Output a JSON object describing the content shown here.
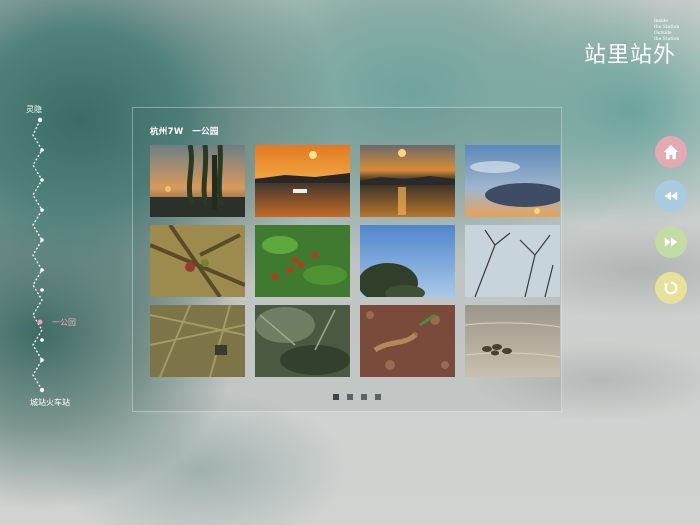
{
  "gallery": {
    "title": "杭州7W　一公园",
    "photos": [
      {
        "name": "willow-sunset-lake",
        "scene": "sunset"
      },
      {
        "name": "orange-sunset-boat",
        "scene": "sunset"
      },
      {
        "name": "golden-sunset-hills",
        "scene": "sunset"
      },
      {
        "name": "blue-sky-sunset",
        "scene": "sky"
      },
      {
        "name": "branch-buds",
        "scene": "branch"
      },
      {
        "name": "red-berries-leaves",
        "scene": "plant"
      },
      {
        "name": "tree-blue-sky",
        "scene": "sky"
      },
      {
        "name": "bare-branches-sky",
        "scene": "branch"
      },
      {
        "name": "dry-bushes",
        "scene": "plant"
      },
      {
        "name": "dark-garden-plants",
        "scene": "plant"
      },
      {
        "name": "fallen-leaves-ground",
        "scene": "ground"
      },
      {
        "name": "ducks-on-water",
        "scene": "water"
      }
    ],
    "page_count": 4,
    "current_page": 1
  },
  "route": {
    "start_label": "灵隐",
    "current_label": "一公园",
    "end_label": "城站火车站"
  },
  "logo": {
    "brand_text": "站里站外",
    "small_text": [
      "Inside",
      "the Station",
      "Outside",
      "the Station"
    ]
  },
  "buttons": {
    "home": {
      "icon": "home-icon",
      "color": "#e5a9b4"
    },
    "rewind": {
      "icon": "rewind-icon",
      "color": "#a9cbe0"
    },
    "fast_forward": {
      "icon": "fast-forward-icon",
      "color": "#c2dca3"
    },
    "replay": {
      "icon": "replay-icon",
      "color": "#e8e19a"
    }
  }
}
